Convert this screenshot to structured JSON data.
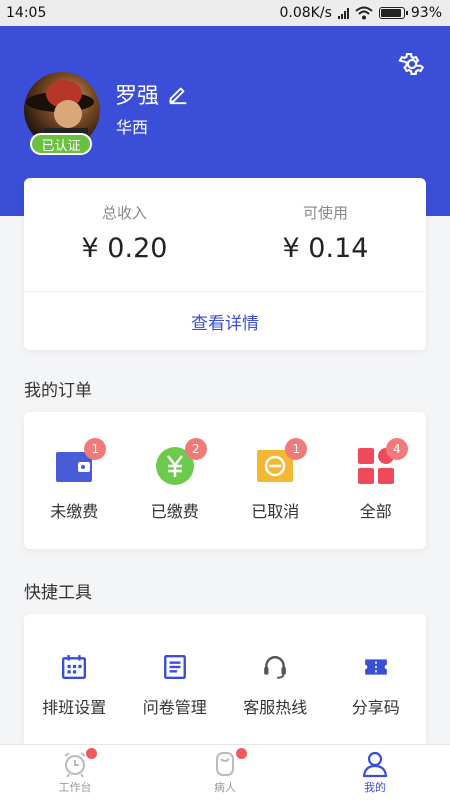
{
  "status_bar": {
    "time": "14:05",
    "speed": "0.08K/s",
    "battery": "93%",
    "battery_level": 0.93
  },
  "profile": {
    "name": "罗强",
    "hospital": "华西",
    "verified_label": "已认证"
  },
  "income": {
    "total_label": "总收入",
    "total_value": "¥ 0.20",
    "available_label": "可使用",
    "available_value": "¥ 0.14",
    "detail_link": "查看详情"
  },
  "orders": {
    "title": "我的订单",
    "items": [
      {
        "label": "未缴费",
        "badge": "1",
        "icon": "wallet-icon",
        "color": "#4a5bd8"
      },
      {
        "label": "已缴费",
        "badge": "2",
        "icon": "yen-icon",
        "color": "#6ccb4c"
      },
      {
        "label": "已取消",
        "badge": "1",
        "icon": "cancel-icon",
        "color": "#f5b731"
      },
      {
        "label": "全部",
        "badge": "4",
        "icon": "grid-icon",
        "color": "#ef4a5c"
      }
    ]
  },
  "tools": {
    "title": "快捷工具",
    "items": [
      {
        "label": "排班设置",
        "icon": "calendar-icon"
      },
      {
        "label": "问卷管理",
        "icon": "document-icon"
      },
      {
        "label": "客服热线",
        "icon": "headset-icon"
      },
      {
        "label": "分享码",
        "icon": "ticket-icon"
      }
    ]
  },
  "tabbar": {
    "items": [
      {
        "label": "工作台",
        "icon": "alarm-clock-icon",
        "active": false,
        "dot": true
      },
      {
        "label": "病人",
        "icon": "patient-icon",
        "active": false,
        "dot": true
      },
      {
        "label": "我的",
        "icon": "person-icon",
        "active": true,
        "dot": false
      }
    ]
  },
  "colors": {
    "primary": "#3a4ed8",
    "verified": "#6bc03f",
    "badge": "#f07a7a"
  }
}
